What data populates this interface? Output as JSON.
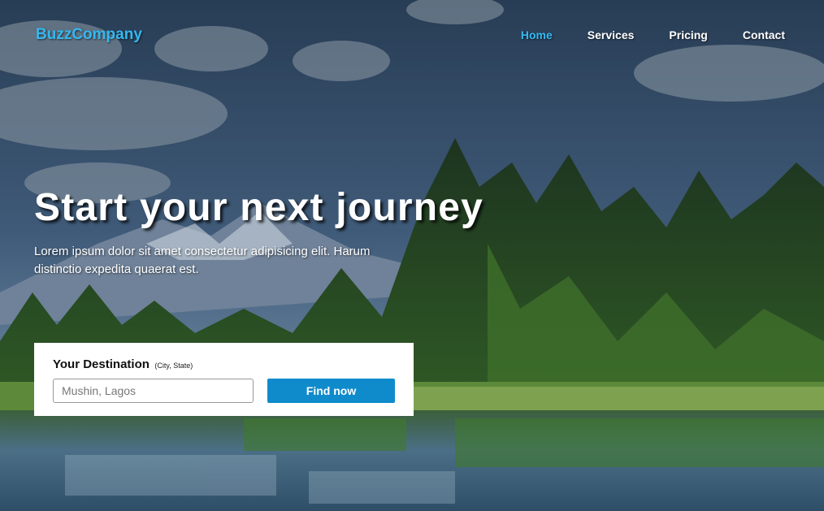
{
  "brand": {
    "name": "BuzzCompany"
  },
  "nav": {
    "items": [
      {
        "label": "Home",
        "active": true
      },
      {
        "label": "Services",
        "active": false
      },
      {
        "label": "Pricing",
        "active": false
      },
      {
        "label": "Contact",
        "active": false
      }
    ]
  },
  "hero": {
    "title": "Start your next journey",
    "lead": "Lorem ipsum dolor sit amet consectetur adipisicing elit. Harum distinctio expedita quaerat est."
  },
  "search": {
    "label": "Your Destination",
    "hint": "(City, State)",
    "placeholder": "Mushin, Lagos",
    "button_label": "Find now"
  },
  "colors": {
    "accent": "#35b8f0",
    "button": "#0f8bcc",
    "card": "#ffffff"
  }
}
